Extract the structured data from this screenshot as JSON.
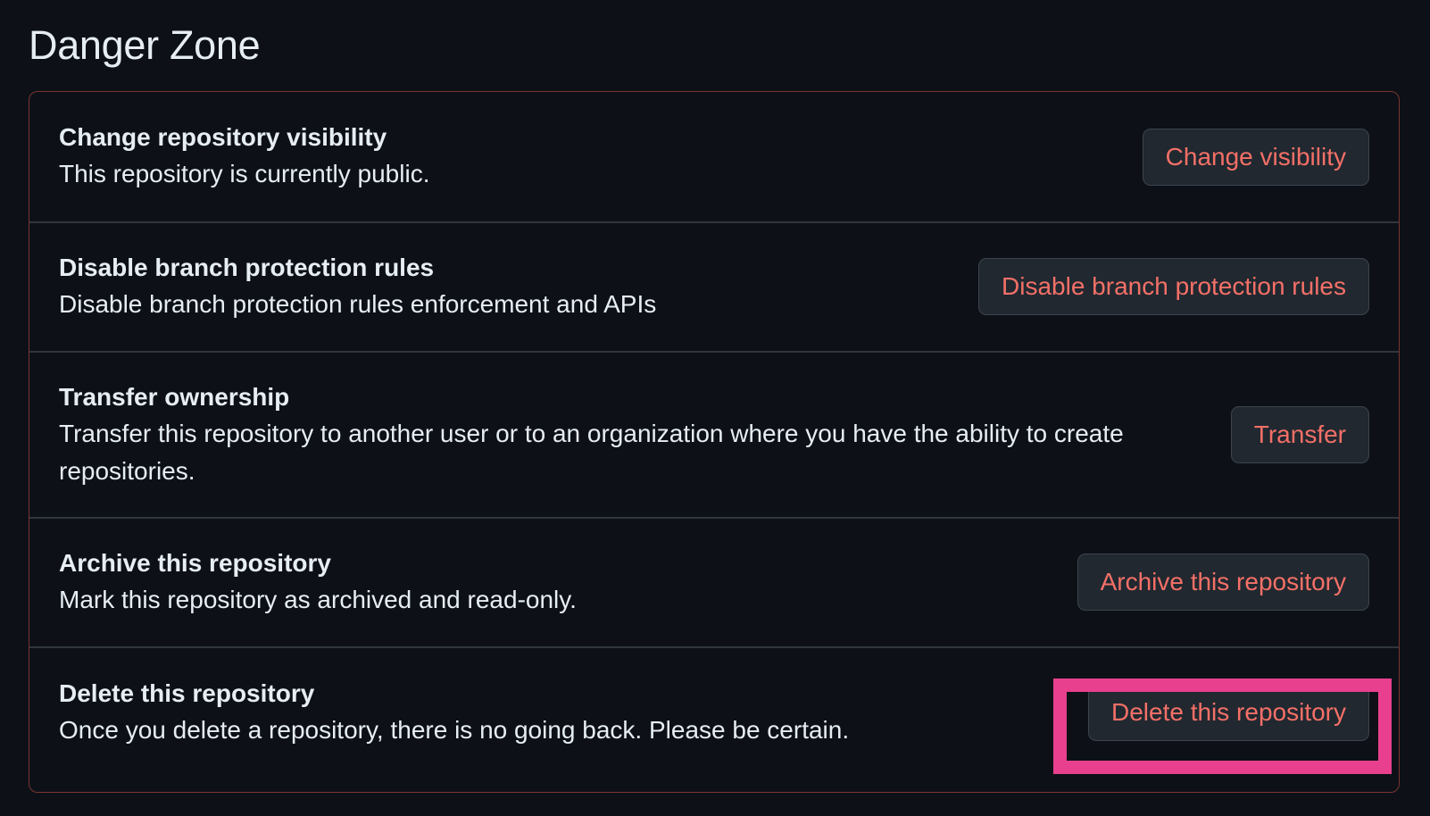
{
  "section": {
    "title": "Danger Zone"
  },
  "rows": [
    {
      "title": "Change repository visibility",
      "description": "This repository is currently public.",
      "button": "Change visibility"
    },
    {
      "title": "Disable branch protection rules",
      "description": "Disable branch protection rules enforcement and APIs",
      "button": "Disable branch protection rules"
    },
    {
      "title": "Transfer ownership",
      "description": "Transfer this repository to another user or to an organization where you have the ability to create repositories.",
      "button": "Transfer"
    },
    {
      "title": "Archive this repository",
      "description": "Mark this repository as archived and read-only.",
      "button": "Archive this repository"
    },
    {
      "title": "Delete this repository",
      "description": "Once you delete a repository, there is no going back. Please be certain.",
      "button": "Delete this repository"
    }
  ],
  "colors": {
    "background": "#0d1117",
    "danger_border": "#7a3431",
    "danger_text": "#f47067",
    "button_bg": "#212830",
    "highlight": "#e8408e"
  }
}
